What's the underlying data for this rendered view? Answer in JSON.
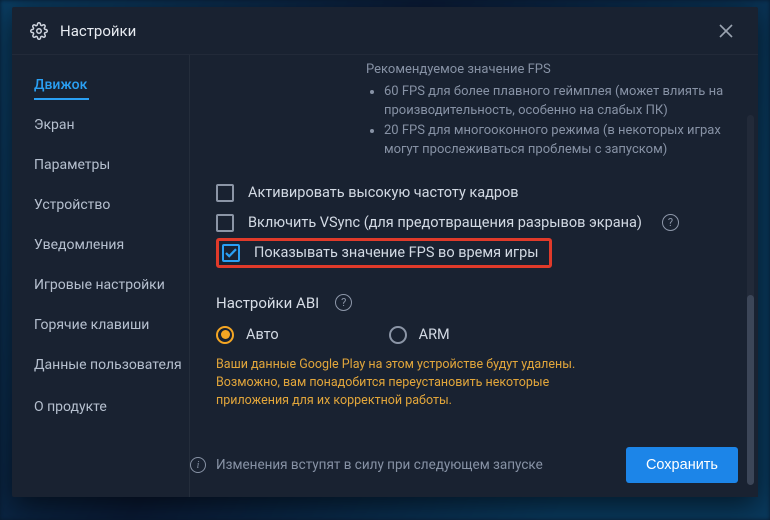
{
  "window": {
    "title": "Настройки"
  },
  "sidebar": {
    "items": [
      {
        "label": "Движок",
        "active": true
      },
      {
        "label": "Экран"
      },
      {
        "label": "Параметры"
      },
      {
        "label": "Устройство"
      },
      {
        "label": "Уведомления"
      },
      {
        "label": "Игровые настройки"
      },
      {
        "label": "Горячие клавиши"
      },
      {
        "label": "Данные пользователя"
      },
      {
        "label": "О продукте"
      }
    ]
  },
  "fps": {
    "recommended": "Рекомендуемое значение FPS",
    "bullets": [
      "60 FPS для более плавного геймплея (может влиять на производительность, особенно на слабых ПК)",
      "20 FPS для многооконного режима (в некоторых играх могут прослеживаться проблемы с запуском)"
    ]
  },
  "checks": {
    "high_fps": {
      "label": "Активировать высокую частоту кадров",
      "checked": false
    },
    "vsync": {
      "label": "Включить VSync (для предотвращения разрывов экрана)",
      "checked": false
    },
    "show_fps": {
      "label": "Показывать значение FPS во время игры",
      "checked": true
    }
  },
  "abi": {
    "title": "Настройки ABI",
    "options": {
      "auto": "Авто",
      "arm": "ARM"
    },
    "selected": "auto",
    "warning": "Ваши данные Google Play на этом устройстве будут удалены. Возможно, вам понадобится переустановить некоторые приложения для их корректной работы."
  },
  "footer": {
    "restart_notice": "Изменения вступят в силу при следующем запуске",
    "save_label": "Сохранить"
  }
}
